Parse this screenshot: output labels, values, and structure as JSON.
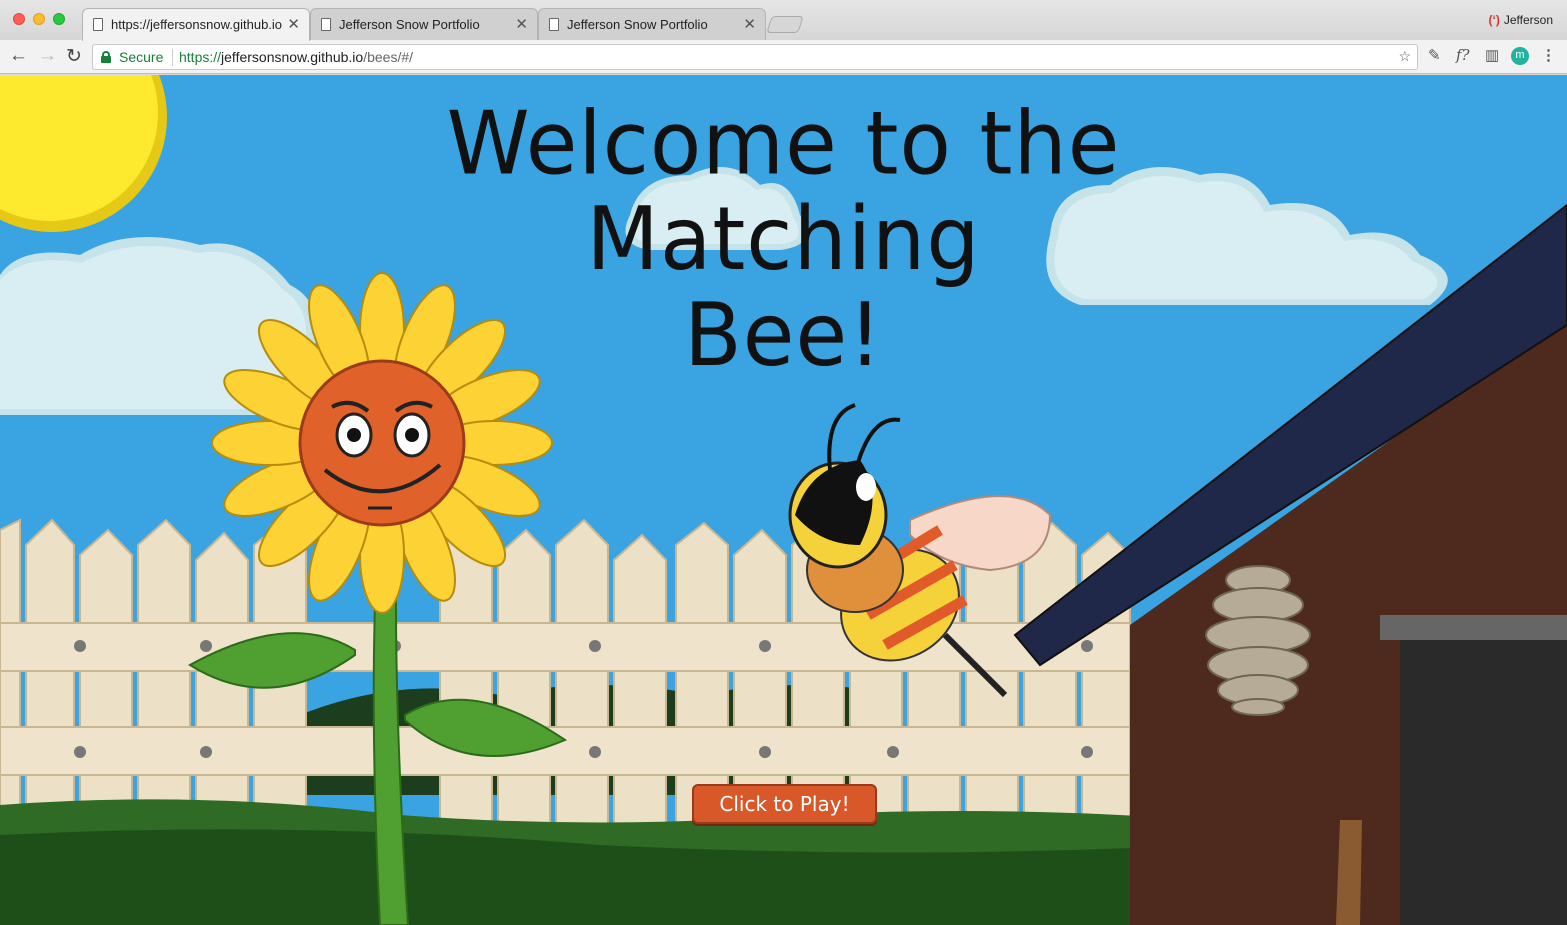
{
  "browser": {
    "profile_name": "Jefferson",
    "tabs": [
      {
        "title": "https://jeffersonsnow.github.io",
        "active": true
      },
      {
        "title": "Jefferson Snow Portfolio",
        "active": false
      },
      {
        "title": "Jefferson Snow Portfolio",
        "active": false
      }
    ],
    "address": {
      "security_label": "Secure",
      "scheme": "https://",
      "host": "jeffersonsnow.github.io",
      "path": "/bees/#/"
    }
  },
  "page": {
    "heading_line1": "Welcome to the Matching",
    "heading_line2": "Bee!",
    "play_button": "Click to Play!"
  },
  "colors": {
    "sky": "#3aa3e2",
    "sun": "#fdea2e",
    "button": "#d9582a",
    "grass": "#2f6b24"
  }
}
